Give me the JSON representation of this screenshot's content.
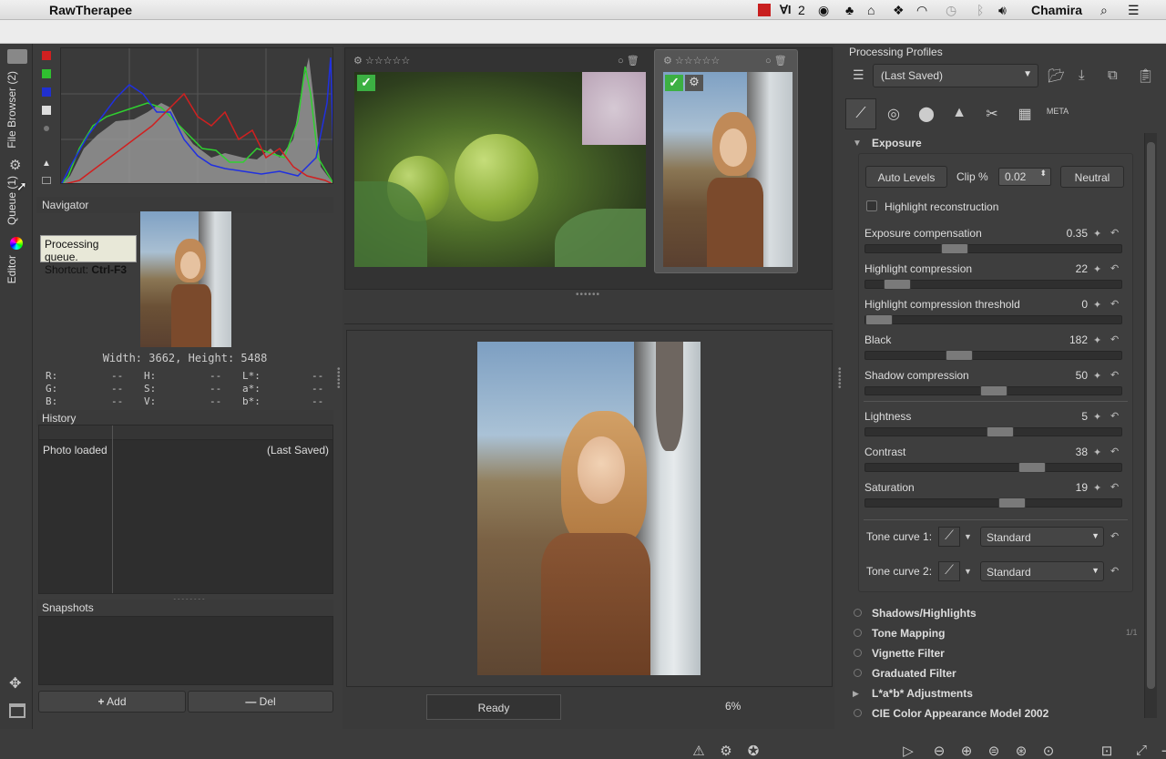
{
  "menubar": {
    "app_name": "RawTherapee",
    "badge_count": "2",
    "user": "Chamira"
  },
  "vertical_tabs": {
    "file_browser": "File Browser (2)",
    "queue": "Queue (1)",
    "editor": "Editor"
  },
  "tooltip": {
    "line1": "Processing queue.",
    "line2_prefix": "Shortcut: ",
    "line2_key": "Ctrl-F3"
  },
  "navigator": {
    "title": "Navigator",
    "dimensions": "Width: 3662, Height: 5488",
    "rows": [
      {
        "a_label": "R:",
        "a_val": "--",
        "b_label": "H:",
        "b_val": "--",
        "c_label": "L*:",
        "c_val": "--"
      },
      {
        "a_label": "G:",
        "a_val": "--",
        "b_label": "S:",
        "b_val": "--",
        "c_label": "a*:",
        "c_val": "--"
      },
      {
        "a_label": "B:",
        "a_val": "--",
        "b_label": "V:",
        "b_val": "--",
        "c_label": "b*:",
        "c_val": "--"
      }
    ]
  },
  "history": {
    "title": "History",
    "row_action": "Photo loaded",
    "row_profile": "(Last Saved)"
  },
  "snapshots": {
    "title": "Snapshots",
    "add_label": "Add",
    "del_label": "Del"
  },
  "statusbar": {
    "status": "Ready",
    "zoom": "6%"
  },
  "profiles": {
    "title": "Processing Profiles",
    "selected": "(Last Saved)"
  },
  "exposure": {
    "title": "Exposure",
    "auto_levels": "Auto Levels",
    "clip_label": "Clip %",
    "clip_value": "0.02",
    "neutral": "Neutral",
    "highlight_reconstruction": "Highlight reconstruction",
    "sliders": [
      {
        "label": "Exposure compensation",
        "value": "0.35",
        "pos": 0.33
      },
      {
        "label": "Highlight compression",
        "value": "22",
        "pos": 0.08
      },
      {
        "label": "Highlight compression threshold",
        "value": "0",
        "pos": 0.0
      },
      {
        "label": "Black",
        "value": "182",
        "pos": 0.35
      },
      {
        "label": "Shadow compression",
        "value": "50",
        "pos": 0.5
      },
      {
        "label": "Lightness",
        "value": "5",
        "pos": 0.53
      },
      {
        "label": "Contrast",
        "value": "38",
        "pos": 0.67
      },
      {
        "label": "Saturation",
        "value": "19",
        "pos": 0.58
      }
    ],
    "tone_curve_1_label": "Tone curve 1:",
    "tone_curve_1_value": "Standard",
    "tone_curve_2_label": "Tone curve 2:",
    "tone_curve_2_value": "Standard"
  },
  "sections": [
    "Shadows/Highlights",
    "Tone Mapping",
    "Vignette Filter",
    "Graduated Filter",
    "L*a*b* Adjustments",
    "CIE Color Appearance Model 2002"
  ],
  "tone_mapping_badge": "1/1",
  "meta_tab": "META",
  "colors": {
    "accent_green": "#3cb043",
    "hist_red": "#d02020",
    "hist_green": "#30d030",
    "hist_blue": "#2030e0"
  }
}
